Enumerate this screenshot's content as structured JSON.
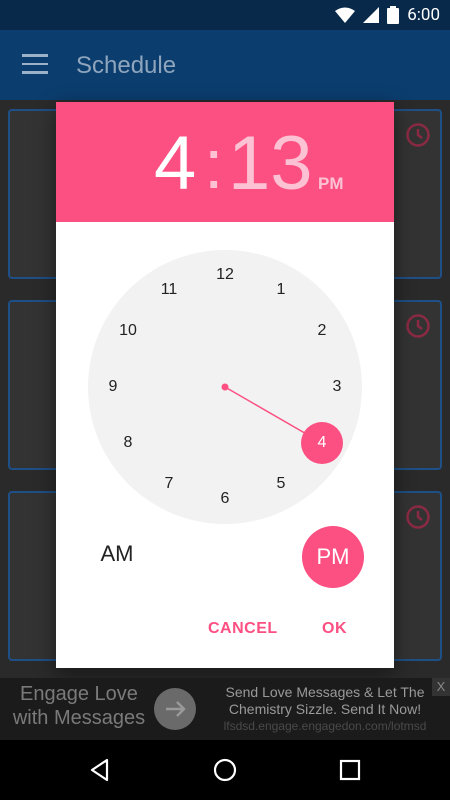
{
  "status_bar": {
    "time": "6:00"
  },
  "app_bar": {
    "title": "Schedule"
  },
  "dialog": {
    "hour": "4",
    "separator": ":",
    "minute": "13",
    "ampm_header": "PM",
    "clock_numbers": [
      "12",
      "1",
      "2",
      "3",
      "4",
      "5",
      "6",
      "7",
      "8",
      "9",
      "10",
      "11"
    ],
    "selected_hour": "4",
    "am_label": "AM",
    "pm_label": "PM",
    "selected_period": "PM",
    "cancel_label": "CANCEL",
    "ok_label": "OK"
  },
  "ad": {
    "left_text": "Engage Love with Messages",
    "right_text": "Send Love Messages & Let The Chemistry Sizzle. Send It Now!",
    "url_text": "lfsdsd.engage.engagedon.com/lotmsd",
    "close_label": "X"
  },
  "colors": {
    "accent": "#fc4f82",
    "app_bar": "#0b3d6e",
    "status_bar": "#08294a"
  }
}
